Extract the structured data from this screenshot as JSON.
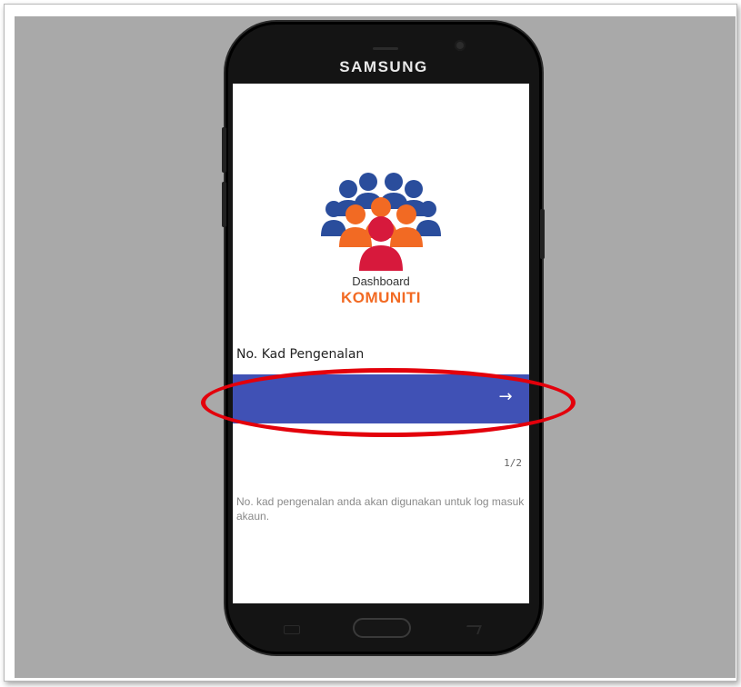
{
  "device": {
    "brand": "SAMSUNG"
  },
  "app": {
    "logo_line1": "Dashboard",
    "logo_line2": "KOMUNITI",
    "field_label": "No. Kad Pengenalan",
    "input_value": "",
    "next_icon": "arrow-right-icon",
    "step_indicator": "1/2",
    "help_text": "No. kad pengenalan anda akan digunakan untuk log masuk akaun."
  },
  "annotation": {
    "highlight_color": "#e3000b"
  },
  "colors": {
    "input_bar": "#4051b5",
    "logo_orange": "#f26a23",
    "logo_blue": "#2a4d9c",
    "logo_red": "#d7193c",
    "background": "#a9a9a9"
  }
}
